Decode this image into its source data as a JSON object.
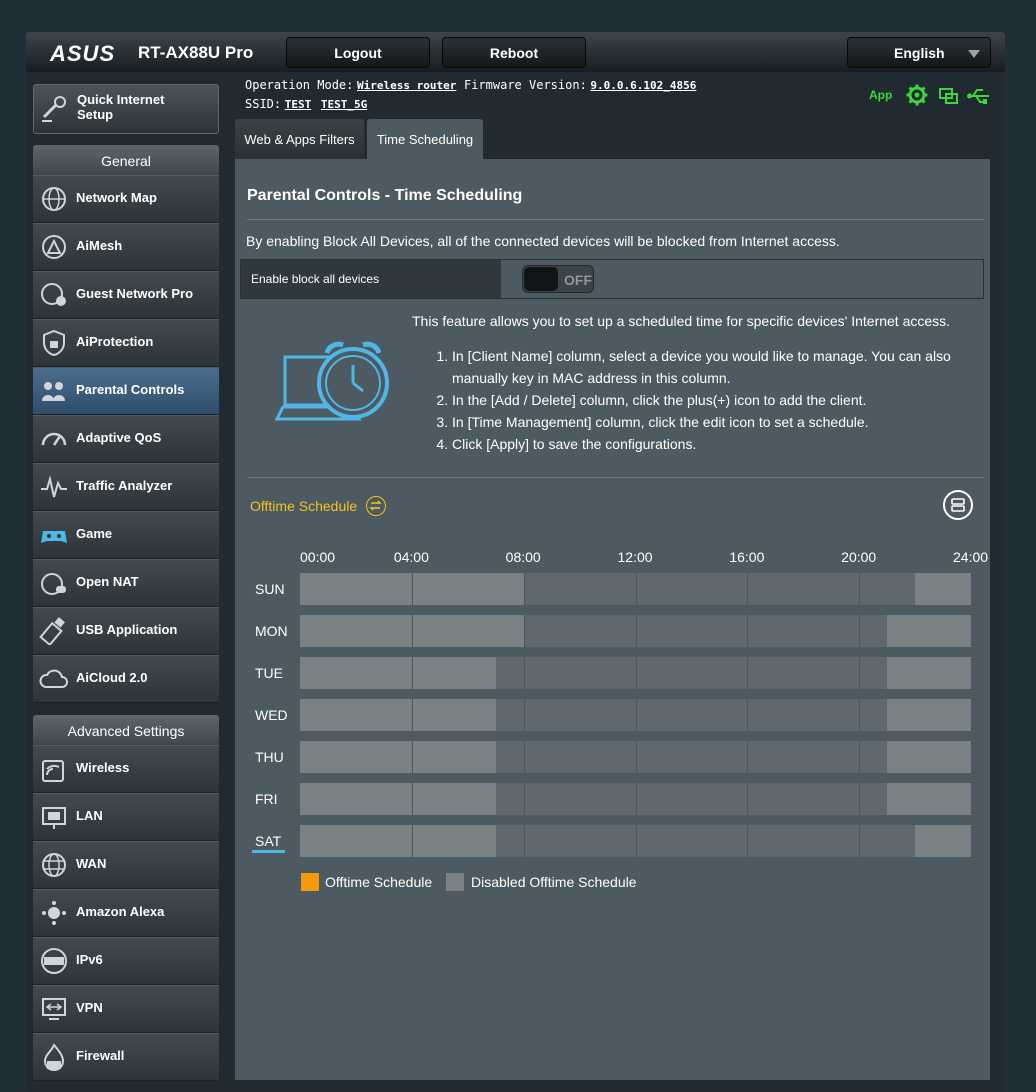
{
  "header": {
    "logo": "ASUS",
    "model": "RT-AX88U Pro",
    "logout_label": "Logout",
    "reboot_label": "Reboot",
    "language": "English"
  },
  "status": {
    "operation_mode_label": "Operation Mode:",
    "operation_mode_value": "Wireless router",
    "firmware_label": "Firmware Version:",
    "firmware_value": "9.0.0.6.102_4856",
    "ssid_label": "SSID:",
    "ssid_1": "TEST",
    "ssid_2": "TEST_5G",
    "app_label": "App",
    "icons": [
      "gear-icon",
      "network-status-icon",
      "usb-icon"
    ]
  },
  "sidebar": {
    "quick_setup": "Quick Internet\nSetup",
    "general_title": "General",
    "general_items": [
      {
        "label": "Network Map",
        "icon": "globe-icon",
        "active": false
      },
      {
        "label": "AiMesh",
        "icon": "aimesh-icon",
        "active": false
      },
      {
        "label": "Guest Network Pro",
        "icon": "guest-network-icon",
        "active": false
      },
      {
        "label": "AiProtection",
        "icon": "shield-lock-icon",
        "active": false
      },
      {
        "label": "Parental Controls",
        "icon": "family-icon",
        "active": true
      },
      {
        "label": "Adaptive QoS",
        "icon": "speedometer-icon",
        "active": false
      },
      {
        "label": "Traffic Analyzer",
        "icon": "traffic-wave-icon",
        "active": false
      },
      {
        "label": "Game",
        "icon": "gamepad-icon",
        "active": false
      },
      {
        "label": "Open NAT",
        "icon": "open-nat-icon",
        "active": false
      },
      {
        "label": "USB Application",
        "icon": "usb-stick-icon",
        "active": false
      },
      {
        "label": "AiCloud 2.0",
        "icon": "cloud-icon",
        "active": false
      }
    ],
    "advanced_title": "Advanced Settings",
    "advanced_items": [
      {
        "label": "Wireless",
        "icon": "wifi-icon"
      },
      {
        "label": "LAN",
        "icon": "lan-icon"
      },
      {
        "label": "WAN",
        "icon": "wan-globe-icon"
      },
      {
        "label": "Amazon Alexa",
        "icon": "alexa-icon"
      },
      {
        "label": "IPv6",
        "icon": "ipv6-icon"
      },
      {
        "label": "VPN",
        "icon": "vpn-icon"
      },
      {
        "label": "Firewall",
        "icon": "firewall-icon"
      }
    ]
  },
  "tabs": [
    {
      "label": "Web & Apps Filters",
      "active": false
    },
    {
      "label": "Time Scheduling",
      "active": true
    }
  ],
  "main": {
    "title": "Parental Controls - Time Scheduling",
    "description": "By enabling Block All Devices, all of the connected devices will be blocked from Internet access.",
    "block_all_label": "Enable block all devices",
    "block_all_state": "OFF",
    "feature_intro": "This feature allows you to set up a scheduled time for specific devices' Internet access.",
    "steps": [
      "In [Client Name] column, select a device you would like to manage. You can also manually key in MAC address in this column.",
      "In the [Add / Delete] column, click the plus(+) icon to add the client.",
      "In [Time Management] column, click the edit icon to set a schedule.",
      "Click [Apply] to save the configurations."
    ]
  },
  "schedule": {
    "title": "Offtime Schedule",
    "hours": [
      "00:00",
      "04:00",
      "08:00",
      "12:00",
      "16:00",
      "20:00",
      "24:00"
    ],
    "days": [
      {
        "label": "SUN",
        "disabled_ranges": [
          [
            0,
            8
          ],
          [
            22,
            24
          ]
        ],
        "selected": false
      },
      {
        "label": "MON",
        "disabled_ranges": [
          [
            0,
            8
          ],
          [
            21,
            24
          ]
        ],
        "selected": false
      },
      {
        "label": "TUE",
        "disabled_ranges": [
          [
            0,
            7
          ],
          [
            21,
            24
          ]
        ],
        "selected": false
      },
      {
        "label": "WED",
        "disabled_ranges": [
          [
            0,
            7
          ],
          [
            21,
            24
          ]
        ],
        "selected": false
      },
      {
        "label": "THU",
        "disabled_ranges": [
          [
            0,
            7
          ],
          [
            21,
            24
          ]
        ],
        "selected": false
      },
      {
        "label": "FRI",
        "disabled_ranges": [
          [
            0,
            7
          ],
          [
            21,
            24
          ]
        ],
        "selected": false
      },
      {
        "label": "SAT",
        "disabled_ranges": [
          [
            0,
            7
          ],
          [
            22,
            24
          ]
        ],
        "selected": true
      }
    ],
    "legend": [
      {
        "label": "Offtime Schedule",
        "color": "#f59a0c"
      },
      {
        "label": "Disabled Offtime Schedule",
        "color": "#7a8286"
      }
    ]
  }
}
